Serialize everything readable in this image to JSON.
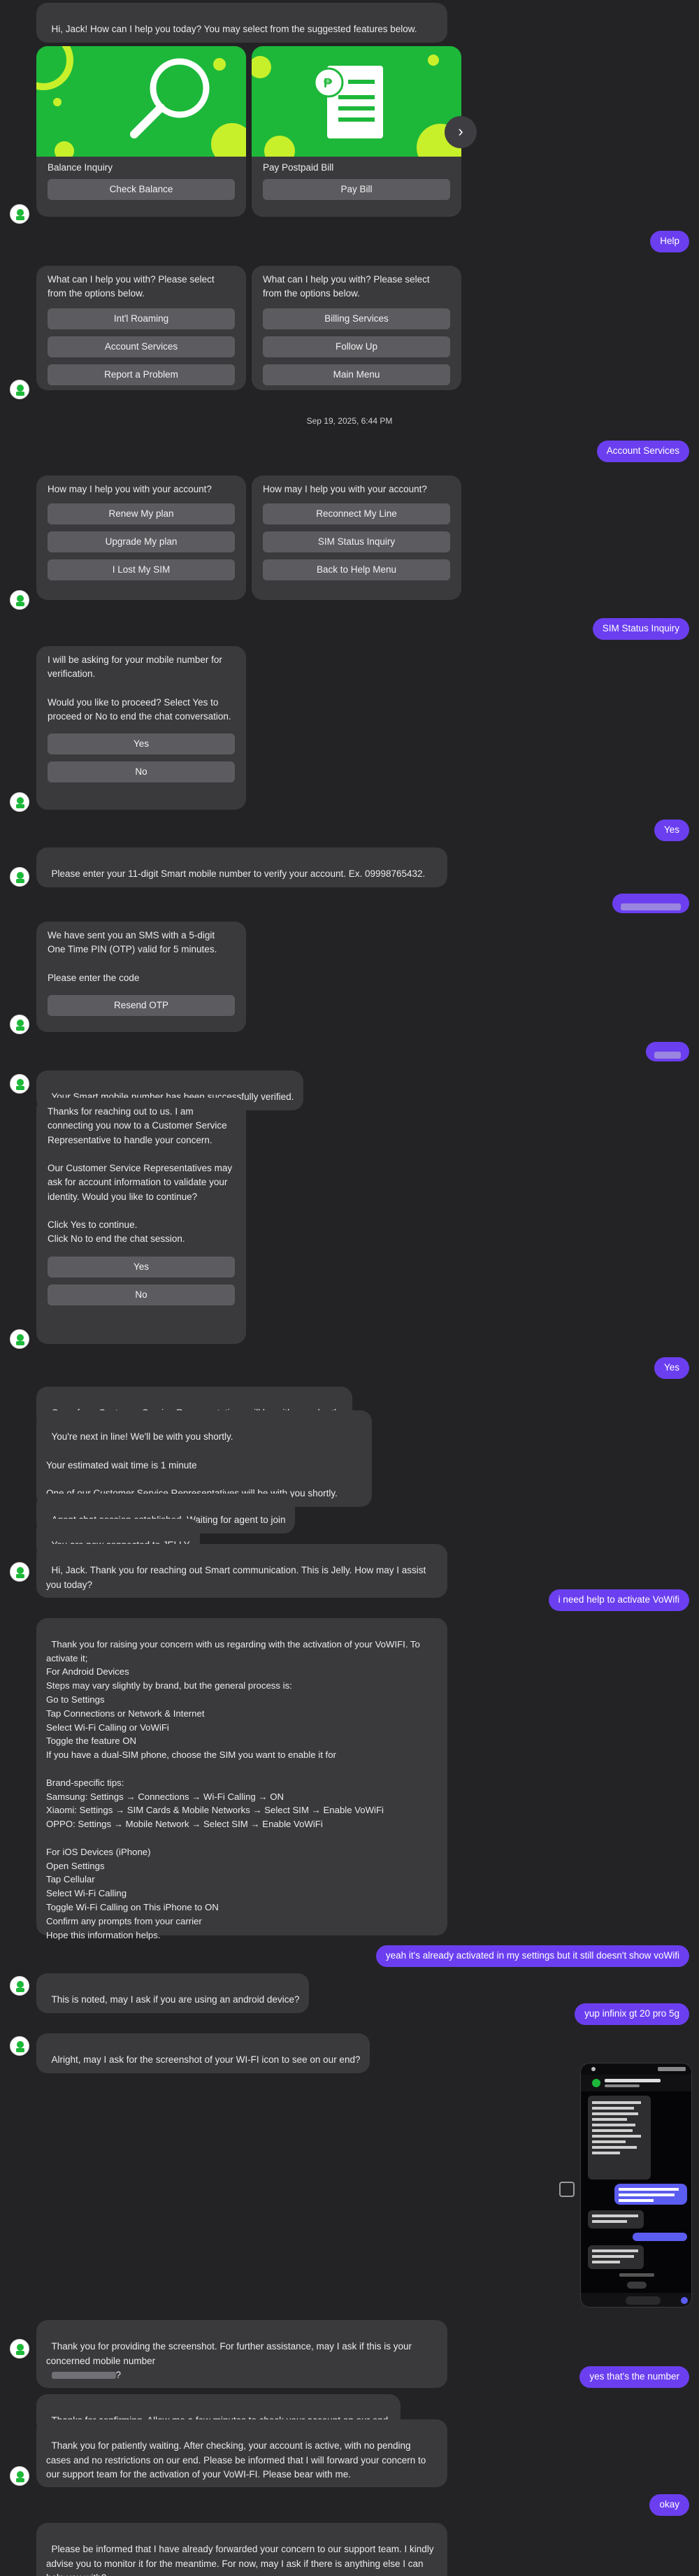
{
  "messages": {
    "greeting": "Hi, Jack! How can I help you today? You may select from the suggested features below.",
    "card_balance_title": "Balance Inquiry",
    "card_balance_btn": "Check Balance",
    "card_postpaid_title": "Pay Postpaid Bill",
    "card_postpaid_btn": "Pay Bill",
    "user_help": "Help",
    "help_prompt_1": "What can I help you with? Please select from the options below.",
    "help_opts_1": [
      "Int'l Roaming",
      "Account Services",
      "Report a Problem"
    ],
    "help_prompt_2": "What can I help you with? Please select from the options below.",
    "help_opts_2": [
      "Billing Services",
      "Follow Up",
      "Main Menu"
    ],
    "timestamp": "Sep 19, 2025, 6:44 PM",
    "user_account_services": "Account Services",
    "acct_prompt_1": "How may I help you with your account?",
    "acct_opts_1": [
      "Renew My plan",
      "Upgrade My plan",
      "I Lost My SIM"
    ],
    "acct_prompt_2": "How may I help you with your account?",
    "acct_opts_2": [
      "Reconnect My Line",
      "SIM Status Inquiry",
      "Back to Help Menu"
    ],
    "user_sim_status": "SIM Status Inquiry",
    "verify_prompt": "I will be asking for your mobile number for verification.\n\nWould you like to proceed? Select Yes to proceed or No to end the chat conversation.",
    "yes_label": "Yes",
    "no_label": "No",
    "user_yes_1": "Yes",
    "enter_number": "Please enter your 11-digit Smart mobile number to verify your account. Ex. 09998765432.",
    "otp_prompt": "We have sent you an SMS with a 5-digit One Time PIN (OTP) valid for 5 minutes.\n\nPlease enter the code",
    "resend_otp": "Resend OTP",
    "verified": "Your Smart mobile number has been successfully verified.",
    "connect_prompt": "Thanks for reaching out to us. I am connecting you now to a Customer Service Representative to handle your concern.\n\nOur Customer Service Representatives may ask for account information to validate your identity. Would you like to continue?\n\nClick Yes to continue.\nClick No to end the chat session.",
    "yes_label_2": "Yes",
    "no_label_2": "No",
    "user_yes_2": "Yes",
    "csr_shortly_1": "One of our Customer Service Representatives will be with you shortly.",
    "queue_msg": "You're next in line! We'll be with you shortly.\n\nYour estimated wait time is 1 minute\n\nOne of our Customer Service Representatives will be with you shortly.",
    "agent_session": "Agent chat session established. Waiting for agent to join",
    "connected_jelly": "You are now connected to JELLY",
    "jelly_greeting": "Hi, Jack. Thank you for reaching out Smart communication. This is Jelly. How may I assist you today?",
    "user_vowifi": "i need help to activate VoWifi",
    "vowifi_steps": "Thank you for raising your concern with us regarding with the activation of your VoWIFI. To activate it;\nFor Android Devices\nSteps may vary slightly by brand, but the general process is:\nGo to Settings\nTap Connections or Network & Internet\nSelect Wi-Fi Calling or VoWiFi\nToggle the feature ON\nIf you have a dual-SIM phone, choose the SIM you want to enable it for\n\nBrand-specific tips:\nSamsung: Settings → Connections → Wi-Fi Calling → ON\nXiaomi: Settings → SIM Cards & Mobile Networks → Select SIM → Enable VoWiFi\nOPPO: Settings → Mobile Network → Select SIM → Enable VoWiFi\n\nFor iOS Devices (iPhone)\nOpen Settings\nTap Cellular\nSelect Wi-Fi Calling\nToggle Wi-Fi Calling on This iPhone to ON\nConfirm any prompts from your carrier\nHope this information helps.",
    "user_already": "yeah it's already activated in my settings but it still doesn't show voWifi",
    "android_q": "This is noted, may I ask if you are using an android device?",
    "user_infinix": "yup infinix gt 20 pro 5g",
    "screenshot_q": "Alright, may I ask for the screenshot of your WI-FI icon to see on our end?",
    "thanks_screenshot": "Thank you for providing the screenshot. For further assistance, may I ask if this is your concerned mobile number",
    "thanks_screenshot_end": "?",
    "user_number": "yes that's the number",
    "thanks_confirm": "Thanks for confirming. Allow me a few minutes to check your account on our end.",
    "patience": "Thank you for patiently waiting. After checking, your account is active, with no pending cases and no restrictions on our end. Please be informed that I will forward your concern to our support team for the activation of your VoWI-FI. Please bear with me.",
    "user_okay": "okay",
    "forwarded": "Please be informed that I have already forwarded your concern to our support team. I kindly advise you to monitor it for the meantime. For now, may I ask if there is anything else I can help you with?"
  },
  "icons": {
    "carousel_next": "chevron-right-icon",
    "avatar": "smart-logo-icon",
    "balance_art": "magnifier-icon",
    "bill_art": "bill-peso-icon"
  },
  "colors": {
    "background": "#232325",
    "bot_bubble": "#3a3a3d",
    "user_bubble": "#6b3ff0",
    "button": "#5c5c60",
    "brand_green": "#1db83a"
  }
}
